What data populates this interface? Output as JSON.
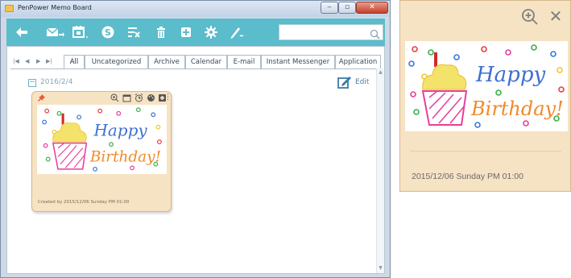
{
  "window": {
    "title": "PenPower Memo Board",
    "controls": {
      "minimize": "‒",
      "maximize": "▫",
      "close": "✕"
    }
  },
  "toolbar": {
    "icons": [
      "back-arrow-icon",
      "mail-send-icon",
      "calendar-icon",
      "skype-icon",
      "filter-icon",
      "trash-icon",
      "add-note-icon",
      "settings-icon",
      "pen-icon"
    ],
    "search": {
      "value": "",
      "placeholder": ""
    }
  },
  "tabs": {
    "nav": [
      "|◀",
      "◀",
      "▶",
      "▶|"
    ],
    "items": [
      "All",
      "Uncategorized",
      "Archive",
      "Calendar",
      "E-mail",
      "Instant Messenger",
      "Application"
    ],
    "active": "All"
  },
  "content": {
    "group_date": "2016/2/4",
    "edit_label": "Edit"
  },
  "memo": {
    "created_label": "Created by",
    "created_value": "2015/12/06 Sunday PM 01:00",
    "image_text": {
      "line1": "Happy",
      "line2": "Birthday!"
    }
  },
  "zoom_panel": {
    "date": "2015/12/06 Sunday PM 01:00",
    "image_text": {
      "line1": "Happy",
      "line2": "Birthday!"
    }
  },
  "colors": {
    "toolbar": "#5bbccc",
    "card": "#f6e3c4",
    "happy_text": "#3f6fd0",
    "birthday_text": "#f08a2a",
    "cupcake": "#e83e9c",
    "frosting": "#f4e36a",
    "candle": "#cf2b2b"
  }
}
